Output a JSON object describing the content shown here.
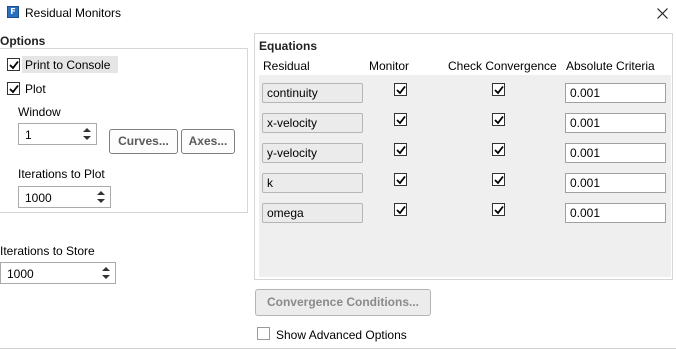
{
  "window": {
    "title": "Residual Monitors",
    "app_icon_letter": "F",
    "close_icon": "close-icon"
  },
  "options": {
    "title": "Options",
    "print_to_console": {
      "label": "Print to Console",
      "checked": true
    },
    "plot": {
      "label": "Plot",
      "checked": true
    },
    "window_label": "Window",
    "window_value": "1",
    "curves_button": "Curves...",
    "axes_button": "Axes...",
    "iterations_to_plot_label": "Iterations to Plot",
    "iterations_to_plot_value": "1000"
  },
  "iterations_to_store": {
    "label": "Iterations to Store",
    "value": "1000"
  },
  "equations": {
    "title": "Equations",
    "headers": {
      "residual": "Residual",
      "monitor": "Monitor",
      "check": "Check Convergence",
      "criteria": "Absolute Criteria"
    },
    "rows": [
      {
        "residual": "continuity",
        "monitor": true,
        "check": true,
        "criteria": "0.001"
      },
      {
        "residual": "x-velocity",
        "monitor": true,
        "check": true,
        "criteria": "0.001"
      },
      {
        "residual": "y-velocity",
        "monitor": true,
        "check": true,
        "criteria": "0.001"
      },
      {
        "residual": "k",
        "monitor": true,
        "check": true,
        "criteria": "0.001"
      },
      {
        "residual": "omega",
        "monitor": true,
        "check": true,
        "criteria": "0.001"
      }
    ]
  },
  "convergence_conditions_button": "Convergence Conditions...",
  "show_advanced": {
    "label": "Show Advanced Options",
    "checked": false
  },
  "colors": {
    "accent": "#2a6fc0",
    "panel": "#efefef",
    "border": "#d6d6d6"
  }
}
